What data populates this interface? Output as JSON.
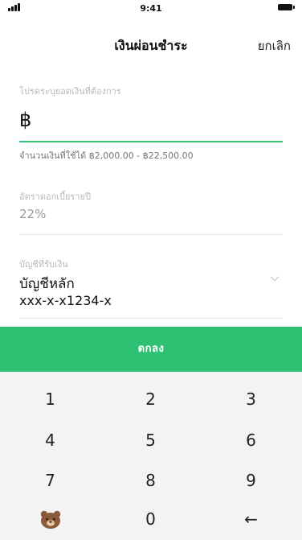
{
  "status_bar": {
    "time": "9:41"
  },
  "header": {
    "title": "เงินผ่อนชำระ",
    "cancel_label": "ยกเลิก"
  },
  "amount": {
    "label": "โปรดระบุยอดเงินที่ต้องการ",
    "currency_symbol": "฿",
    "hint": "จำนวนเงินที่ใช้ได้ ฿2,000.00 - ฿22,500.00"
  },
  "interest": {
    "label": "อัตราดอกเบี้ยรายปี",
    "value": "22%"
  },
  "account": {
    "label": "บัญชีที่รับเงิน",
    "name": "บัญชีหลัก",
    "number": "xxx-x-x1234-x"
  },
  "confirm_label": "ตกลง",
  "keypad": {
    "keys": [
      "1",
      "2",
      "3",
      "4",
      "5",
      "6",
      "7",
      "8",
      "9",
      "0"
    ],
    "backspace": "←",
    "sticker_icon": "bear-face-icon"
  },
  "colors": {
    "accent": "#2fc173",
    "keypad_bg": "#f3f3f3"
  }
}
